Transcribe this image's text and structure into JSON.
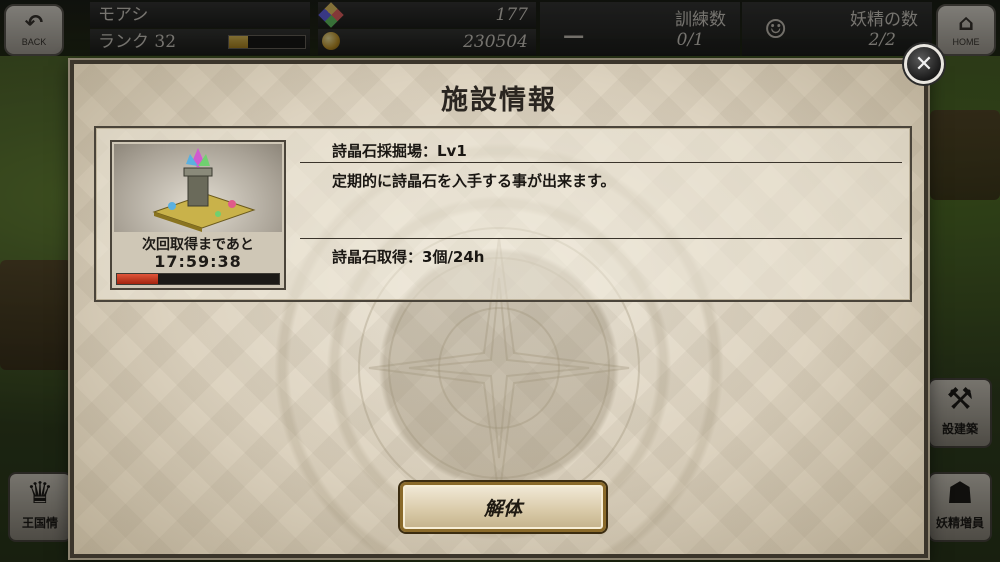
{
  "hud": {
    "back_label": "BACK",
    "home_label": "HOME",
    "player_name": "モアシ",
    "rank_label": "ランク 32",
    "rank_progress": 0.25,
    "gems": "177",
    "coins": "230504",
    "training_title": "訓練数",
    "training_value": "0/1",
    "fairy_title": "妖精の数",
    "fairy_value": "2/2"
  },
  "side_buttons": {
    "kingdom_label": "王国情",
    "build_label": "設建築",
    "fairy_add_label": "妖精増員"
  },
  "modal": {
    "title": "施設情報",
    "next_collect_label": "次回取得まであと",
    "timer": "17:59:38",
    "timer_progress": 0.25,
    "facility_name": "詩晶石採掘場：Lv1",
    "description": "定期的に詩晶石を入手する事が出来ます。",
    "yield_text": "詩晶石取得：3個/24h",
    "dismantle_label": "解体",
    "close_symbol": "✕"
  },
  "icons": {
    "back": "back-arrow-icon",
    "home": "home-icon",
    "gem": "gem-icon",
    "coin": "coin-icon",
    "training": "dumbbell-icon",
    "fairy": "fairy-icon",
    "crown": "crown-icon",
    "hammer": "hammer-icon",
    "cat": "cat-icon",
    "close": "close-icon"
  },
  "colors": {
    "timer_bar": "#c8361c",
    "rank_bar": "#d4a93a",
    "button_border": "#8a6a2a"
  }
}
